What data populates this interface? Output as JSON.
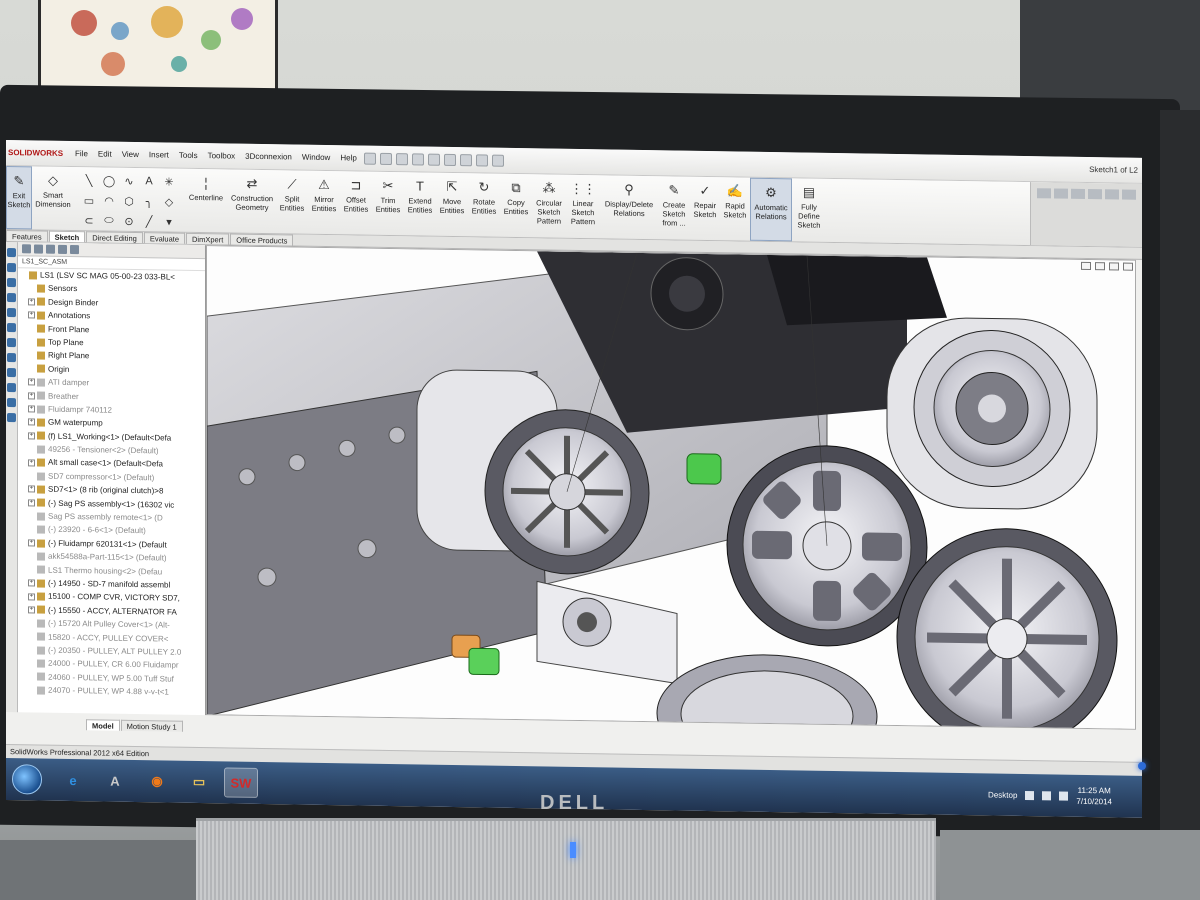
{
  "window": {
    "app_logo": "SOLIDWORKS",
    "doc_title": "Sketch1 of L2"
  },
  "menu": [
    "File",
    "Edit",
    "View",
    "Insert",
    "Tools",
    "Toolbox",
    "3Dconnexion",
    "Window",
    "Help"
  ],
  "ribbon": {
    "exit_sketch": "Exit Sketch",
    "smart_dimension": "Smart Dimension",
    "tools": [
      {
        "label": "Centerline",
        "icon": "centerline-icon"
      },
      {
        "label": "Construction Geometry",
        "icon": "construction-geometry-icon"
      },
      {
        "label": "Split Entities",
        "icon": "split-entities-icon"
      },
      {
        "label": "Mirror Entities",
        "icon": "mirror-entities-icon"
      },
      {
        "label": "Offset Entities",
        "icon": "offset-entities-icon"
      },
      {
        "label": "Trim Entities",
        "icon": "trim-entities-icon"
      },
      {
        "label": "Extend Entities",
        "icon": "extend-entities-icon"
      },
      {
        "label": "Move Entities",
        "icon": "move-entities-icon"
      },
      {
        "label": "Rotate Entities",
        "icon": "rotate-entities-icon"
      },
      {
        "label": "Copy Entities",
        "icon": "copy-entities-icon"
      },
      {
        "label": "Circular Sketch Pattern",
        "icon": "circular-pattern-icon"
      },
      {
        "label": "Linear Sketch Pattern",
        "icon": "linear-pattern-icon"
      },
      {
        "label": "Display/Delete Relations",
        "icon": "relations-icon"
      },
      {
        "label": "Create Sketch from ...",
        "icon": "create-sketch-icon"
      },
      {
        "label": "Repair Sketch",
        "icon": "repair-sketch-icon"
      },
      {
        "label": "Rapid Sketch",
        "icon": "rapid-sketch-icon"
      },
      {
        "label": "Automatic Relations",
        "icon": "automatic-relations-icon",
        "active": true
      },
      {
        "label": "Fully Define Sketch",
        "icon": "fully-define-icon"
      }
    ]
  },
  "tabs": [
    "Features",
    "Sketch",
    "Direct Editing",
    "Evaluate",
    "DimXpert",
    "Office Products"
  ],
  "active_tab": "Sketch",
  "tree": {
    "path": "LS1_SC_ASM",
    "rows": [
      {
        "label": "LS1  (LSV SC MAG 05-00-23 033-BL<",
        "indent": 0,
        "gray": false,
        "expander": ""
      },
      {
        "label": "Sensors",
        "indent": 1,
        "gray": false,
        "expander": ""
      },
      {
        "label": "Design Binder",
        "indent": 1,
        "gray": false,
        "expander": "+"
      },
      {
        "label": "Annotations",
        "indent": 1,
        "gray": false,
        "expander": "+"
      },
      {
        "label": "Front Plane",
        "indent": 1,
        "gray": false,
        "expander": ""
      },
      {
        "label": "Top Plane",
        "indent": 1,
        "gray": false,
        "expander": ""
      },
      {
        "label": "Right Plane",
        "indent": 1,
        "gray": false,
        "expander": ""
      },
      {
        "label": "Origin",
        "indent": 1,
        "gray": false,
        "expander": ""
      },
      {
        "label": "ATI damper",
        "indent": 1,
        "gray": true,
        "expander": "+"
      },
      {
        "label": "Breather",
        "indent": 1,
        "gray": true,
        "expander": "+"
      },
      {
        "label": "Fluidampr 740112",
        "indent": 1,
        "gray": true,
        "expander": "+"
      },
      {
        "label": "GM waterpump",
        "indent": 1,
        "gray": false,
        "expander": "+"
      },
      {
        "label": "(f) LS1_Working<1> (Default<Defa",
        "indent": 1,
        "gray": false,
        "expander": "+"
      },
      {
        "label": "49256 - Tensioner<2> (Default)",
        "indent": 1,
        "gray": true,
        "expander": ""
      },
      {
        "label": "Alt small case<1> (Default<Defa",
        "indent": 1,
        "gray": false,
        "expander": "+"
      },
      {
        "label": "SD7 compressor<1> (Default)",
        "indent": 1,
        "gray": true,
        "expander": ""
      },
      {
        "label": "SD7<1> (8 rib (original clutch)>8",
        "indent": 1,
        "gray": false,
        "expander": "+"
      },
      {
        "label": "(-) Sag PS assembly<1> (16302 vic",
        "indent": 1,
        "gray": false,
        "expander": "+"
      },
      {
        "label": "Sag PS assembly remote<1> (D",
        "indent": 1,
        "gray": true,
        "expander": ""
      },
      {
        "label": "(-) 23920 - 6-6<1> (Default)",
        "indent": 1,
        "gray": true,
        "expander": ""
      },
      {
        "label": "(-) Fluidampr 620131<1> (Default",
        "indent": 1,
        "gray": false,
        "expander": "+"
      },
      {
        "label": "akk54588a-Part-115<1> (Default)",
        "indent": 1,
        "gray": true,
        "expander": ""
      },
      {
        "label": "LS1 Thermo housing<2> (Defau",
        "indent": 1,
        "gray": true,
        "expander": ""
      },
      {
        "label": "(-) 14950 - SD-7 manifold assembl",
        "indent": 1,
        "gray": false,
        "expander": "+"
      },
      {
        "label": "15100 - COMP CVR, VICTORY SD7,",
        "indent": 1,
        "gray": false,
        "expander": "+"
      },
      {
        "label": "(-) 15550 - ACCY, ALTERNATOR FA",
        "indent": 1,
        "gray": false,
        "expander": "+"
      },
      {
        "label": "(-) 15720 Alt Pulley Cover<1> (Alt-",
        "indent": 1,
        "gray": true,
        "expander": ""
      },
      {
        "label": "15820 - ACCY, PULLEY COVER<",
        "indent": 1,
        "gray": true,
        "expander": ""
      },
      {
        "label": "(-) 20350 - PULLEY, ALT PULLEY 2.0",
        "indent": 1,
        "gray": true,
        "expander": ""
      },
      {
        "label": "24000 - PULLEY, CR 6.00 Fluidampr",
        "indent": 1,
        "gray": true,
        "expander": ""
      },
      {
        "label": "24060 - PULLEY, WP 5.00 Tuff Stuf",
        "indent": 1,
        "gray": true,
        "expander": ""
      },
      {
        "label": "24070 - PULLEY, WP 4.88 v-v-t<1",
        "indent": 1,
        "gray": true,
        "expander": ""
      }
    ],
    "bottom_tabs": [
      "Model",
      "Motion Study 1"
    ]
  },
  "status_bar": "SolidWorks Professional 2012 x64 Edition",
  "taskbar": {
    "apps": [
      {
        "name": "internet-explorer",
        "glyph": "e",
        "color": "#2f8fe0"
      },
      {
        "name": "adobe-reader",
        "glyph": "A",
        "color": "#c9c9c9"
      },
      {
        "name": "firefox",
        "glyph": "◉",
        "color": "#f07a1a"
      },
      {
        "name": "explorer",
        "glyph": "▭",
        "color": "#e6c25a"
      },
      {
        "name": "solidworks",
        "glyph": "SW",
        "color": "#d22a2a",
        "active": true
      }
    ],
    "desktop_label": "Desktop",
    "time": "11:25 AM",
    "date": "7/10/2014"
  },
  "monitor": {
    "brand": "DELL"
  }
}
